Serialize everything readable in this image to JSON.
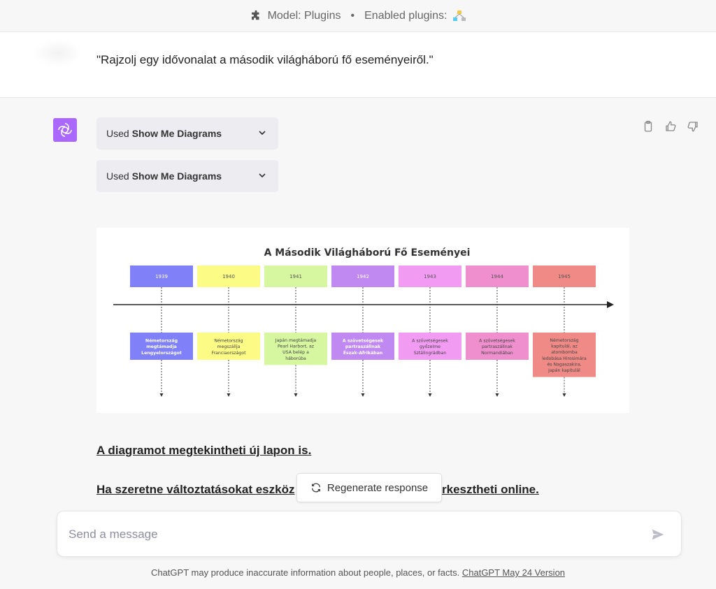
{
  "topbar": {
    "model": "Model: Plugins",
    "separator": "•",
    "enabled": "Enabled plugins:"
  },
  "user_message": "\"Rajzolj egy idővonalat a második világháború fő eseményeiről.\"",
  "plugin_calls": [
    {
      "prefix": "Used",
      "name": "Show Me Diagrams"
    },
    {
      "prefix": "Used",
      "name": "Show Me Diagrams"
    }
  ],
  "diagram": {
    "title": "A Második Világháború Fő Eseményei",
    "events": [
      {
        "year": "1939",
        "text": [
          "Németország",
          "megtámadja",
          "Lengyelországot"
        ],
        "color": "#8080f8",
        "text_color": "#ffffff",
        "bold": true
      },
      {
        "year": "1940",
        "text": [
          "Németország",
          "megszállja",
          "Franciaországot"
        ],
        "color": "#fbfb86",
        "text_color": "#444444",
        "bold": false
      },
      {
        "year": "1941",
        "text": [
          "Japán megtámadja",
          "Pearl Harbort, az",
          "USA belép a",
          "háborúba"
        ],
        "color": "#d6f7a0",
        "text_color": "#444444",
        "bold": false
      },
      {
        "year": "1942",
        "text": [
          "A szövetségesek",
          "partraszállnak",
          "Észak-Afrikában"
        ],
        "color": "#c089f2",
        "text_color": "#ffffff",
        "bold": true
      },
      {
        "year": "1943",
        "text": [
          "A szövetségesek",
          "győzelme",
          "Sztálingrádban"
        ],
        "color": "#f29bf2",
        "text_color": "#444444",
        "bold": false
      },
      {
        "year": "1944",
        "text": [
          "A szövetségesek",
          "partraszállnak",
          "Normandiában"
        ],
        "color": "#ef8fce",
        "text_color": "#444444",
        "bold": false
      },
      {
        "year": "1945",
        "text": [
          "Németország",
          "kapitulál, az",
          "atombomba",
          "ledobása Hirosimára",
          "és Nagaszakira,",
          "Japán kapitulál"
        ],
        "color": "#f08a86",
        "text_color": "#444444",
        "bold": false
      }
    ]
  },
  "links": {
    "view_new_tab": "A diagramot megtekintheti új lapon is.",
    "edit_online_left": "Ha szeretne változtatásokat eszköz",
    "edit_online_right": "rkesztheti online."
  },
  "regenerate_label": "Regenerate response",
  "input": {
    "placeholder": "Send a message"
  },
  "footer": {
    "text": "ChatGPT may produce inaccurate information about people, places, or facts.",
    "version_link": "ChatGPT May 24 Version"
  }
}
